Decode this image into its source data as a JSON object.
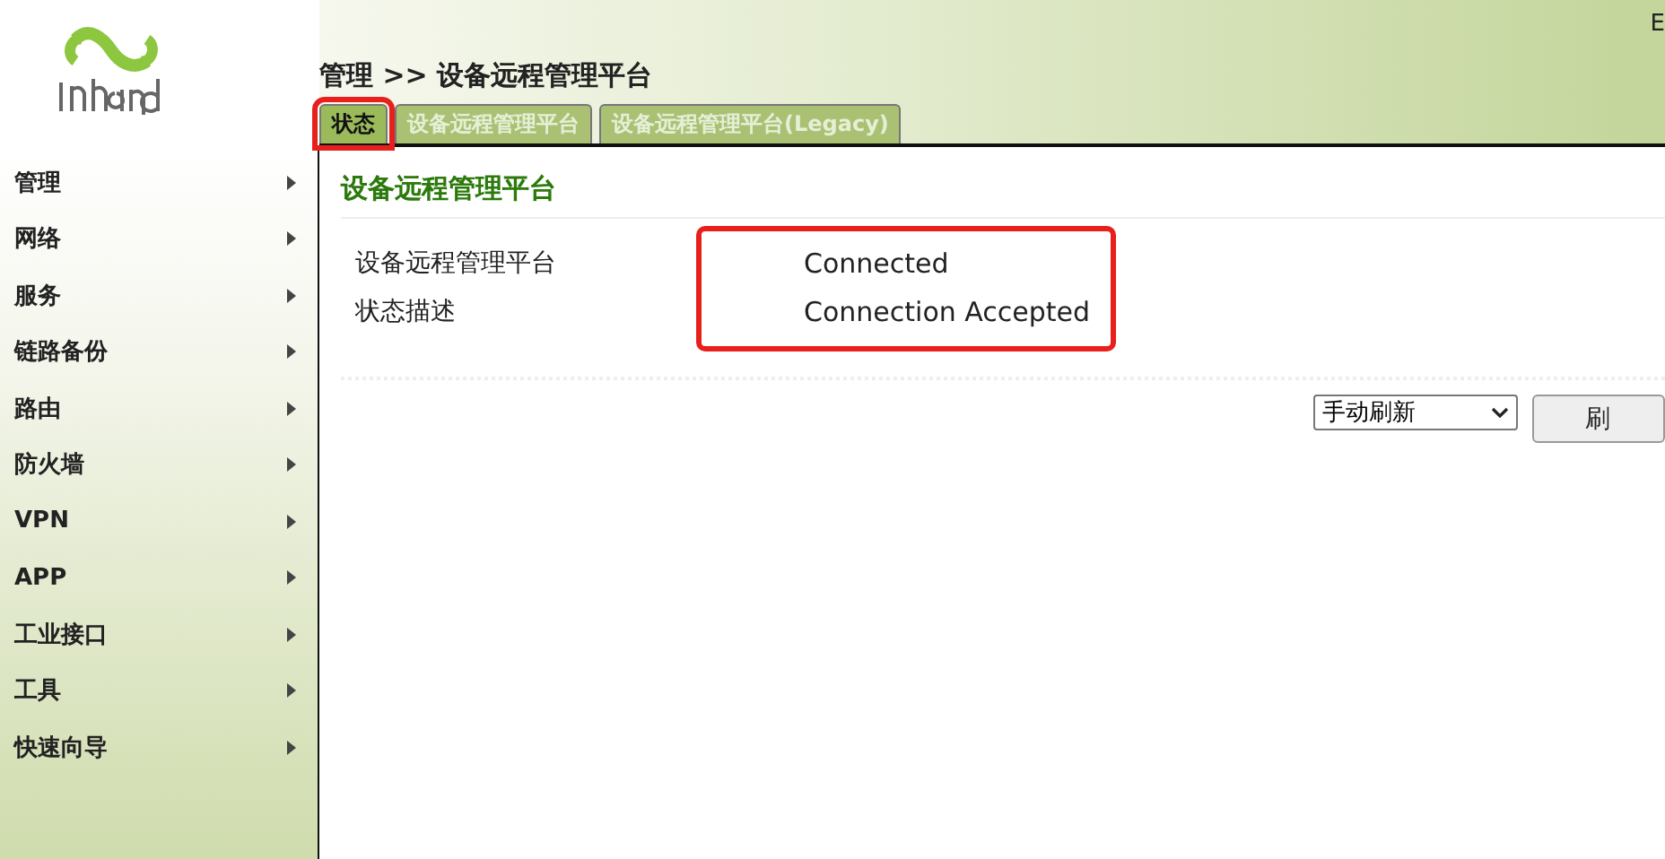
{
  "header": {
    "breadcrumb": "管理 >> 设备远程管理平台",
    "corner_text": "E"
  },
  "tabs": [
    {
      "label": "状态",
      "selected": true,
      "highlighted": true
    },
    {
      "label": "设备远程管理平台",
      "selected": false,
      "highlighted": false
    },
    {
      "label": "设备远程管理平台(Legacy)",
      "selected": false,
      "highlighted": false
    }
  ],
  "sidebar": {
    "items": [
      {
        "label": "管理"
      },
      {
        "label": "网络"
      },
      {
        "label": "服务"
      },
      {
        "label": "链路备份"
      },
      {
        "label": "路由"
      },
      {
        "label": "防火墙"
      },
      {
        "label": "VPN"
      },
      {
        "label": "APP"
      },
      {
        "label": "工业接口"
      },
      {
        "label": "工具"
      },
      {
        "label": "快速向导"
      }
    ]
  },
  "section": {
    "title": "设备远程管理平台",
    "rows": [
      {
        "label": "设备远程管理平台",
        "value": "Connected"
      },
      {
        "label": "状态描述",
        "value": "Connection Accepted"
      }
    ],
    "values_highlighted": true
  },
  "refresh": {
    "select_value": "手动刷新",
    "button": "刷"
  }
}
